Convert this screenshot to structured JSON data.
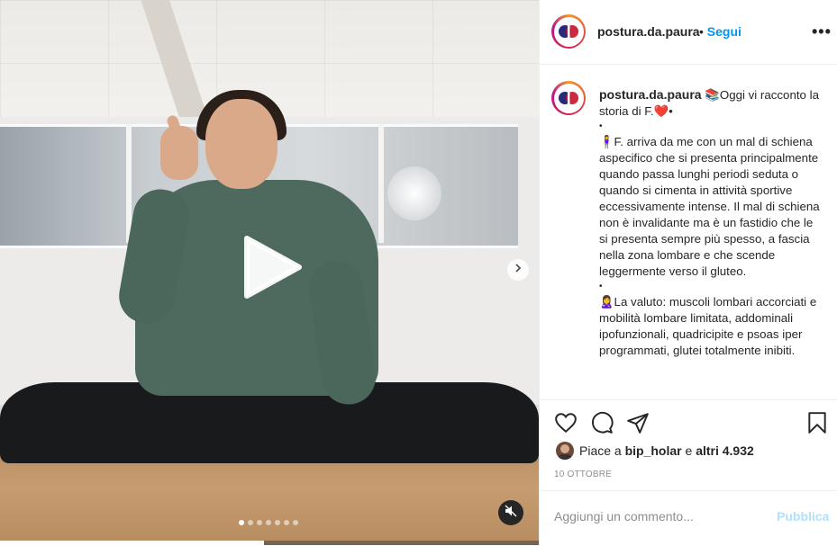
{
  "post": {
    "username": "postura.da.paura",
    "follow_separator": "•",
    "follow_label": "Segui",
    "more_label": "•••"
  },
  "media": {
    "carousel_dots": 7,
    "active_dot": 0,
    "video_progress": 0.49
  },
  "caption": {
    "username": "postura.da.paura",
    "intro": "📚Oggi vi racconto la storia di F.❤️•",
    "bullet1": "•",
    "para1": "🧍‍♀️F. arriva da me con un mal di schiena aspecifico che si presenta principalmente quando passa lunghi periodi seduta o quando si cimenta in attività sportive eccessivamente intense. Il mal di schiena non è invalidante ma è un fastidio che le si presenta sempre più spesso, a fascia nella zona lombare e che scende leggermente verso il gluteo.",
    "bullet2": "•",
    "para2": "🙎‍♀️La valuto: muscoli lombari accorciati e mobilità lombare limitata, addominali ipofunzionali, quadricipite e psoas iper programmati, glutei totalmente inibiti."
  },
  "likes": {
    "prefix": "Piace a",
    "user": "bip_holar",
    "connector": "e",
    "others": "altri 4.932"
  },
  "date": "10 OTTOBRE",
  "comment": {
    "placeholder": "Aggiungi un commento...",
    "publish_label": "Pubblica"
  },
  "colors": {
    "link": "#0095f6",
    "publish_disabled": "#b2dffc",
    "muted_text": "#8e8e8e"
  },
  "icons": [
    "play-icon",
    "chevron-right-icon",
    "mute-icon",
    "heart-icon",
    "comment-icon",
    "share-icon",
    "bookmark-icon"
  ]
}
